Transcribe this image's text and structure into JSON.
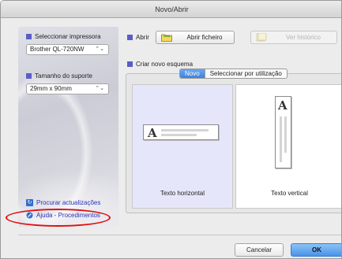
{
  "window": {
    "title": "Novo/Abrir"
  },
  "sidebar": {
    "printer_label": "Seleccionar impressora",
    "printer_value": "Brother QL-720NW",
    "media_label": "Tamanho do suporte",
    "media_value": "29mm x 90mm",
    "updates_link": "Procurar actualizações",
    "help_link": "Ajuda - Procedimentos",
    "popup_arrows": "⌃⌄"
  },
  "open_section": {
    "label": "Abrir",
    "open_file_button": "Abrir ficheiro",
    "history_button": "Ver histórico"
  },
  "create_section": {
    "label": "Criar novo esquema",
    "tabs": [
      {
        "label": "Novo",
        "active": true
      },
      {
        "label": "Seleccionar por utilização",
        "active": false
      }
    ],
    "layouts": {
      "horizontal_caption": "Texto horizontal",
      "vertical_caption": "Texto vertical",
      "glyph": "A"
    }
  },
  "footer": {
    "cancel_button": "Cancelar",
    "ok_button": "OK"
  },
  "colors": {
    "accent_square": "#5a5ec4",
    "ok_button": "#4a93e8",
    "selected_panel": "#e6e6fb",
    "annotation_oval": "#e01010"
  }
}
